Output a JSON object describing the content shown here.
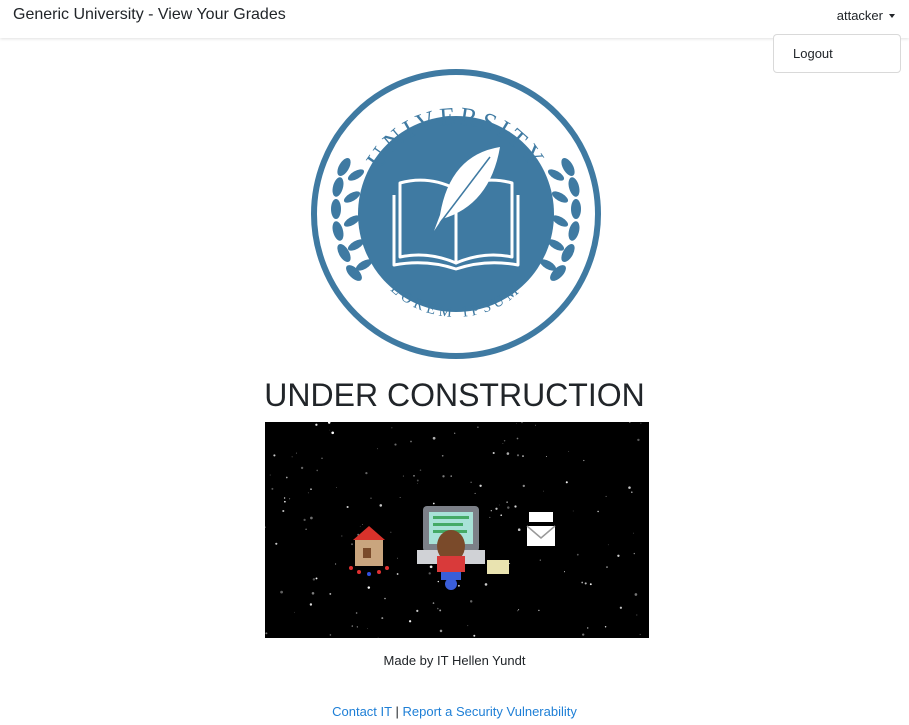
{
  "navbar": {
    "brand": "Generic University - View Your Grades",
    "user": "attacker",
    "menu": {
      "logout": "Logout"
    }
  },
  "logo": {
    "top_text": "UNIVERSITY",
    "bottom_text": "LOREM IPSUM",
    "color": "#3f7aa2"
  },
  "main": {
    "heading": "UNDER CONSTRUCTION",
    "credit": "Made by IT Hellen Yundt"
  },
  "footer": {
    "contact": "Contact IT",
    "separator": "|",
    "report": "Report a Security Vulnerability",
    "link_color": "#1e7fd6"
  }
}
